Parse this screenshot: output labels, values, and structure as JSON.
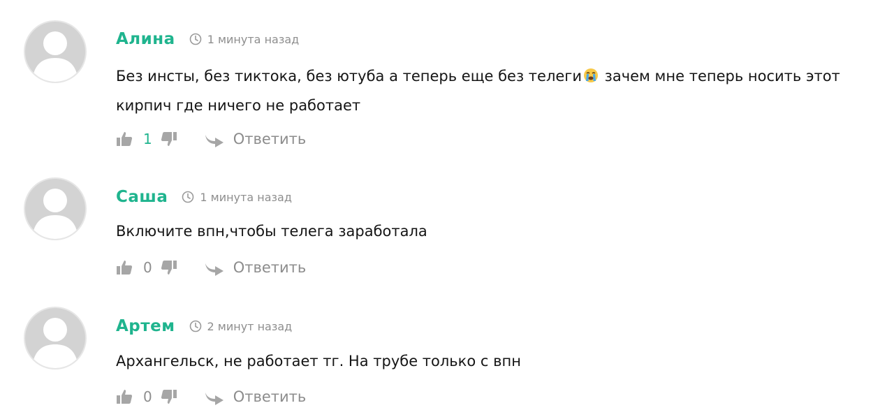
{
  "colors": {
    "accent": "#1fb48e",
    "muted": "#8e8e8e",
    "avatar_bg": "#d3d3d3",
    "icon": "#a6a6a6"
  },
  "comments": [
    {
      "author": "Алина",
      "time": "1 минута назад",
      "text_before_emoji": "Без инсты, без тиктока, без ютуба а теперь еще без телеги",
      "emoji": "loudly-crying-face-emoji",
      "text_after_emoji": " зачем мне теперь носить этот кирпич где ничего не работает",
      "likes": "1",
      "reply_label": "Ответить"
    },
    {
      "author": "Саша",
      "time": "1 минута назад",
      "text_before_emoji": "Включите впн,чтобы телега заработала",
      "text_after_emoji": "",
      "likes": "0",
      "reply_label": "Ответить"
    },
    {
      "author": "Артем",
      "time": "2 минут назад",
      "text_before_emoji": "Архангельск, не работает тг. На трубе только с впн",
      "text_after_emoji": "",
      "likes": "0",
      "reply_label": "Ответить"
    }
  ],
  "icons": {
    "avatar": "default-avatar-icon",
    "clock": "clock-icon",
    "like": "thumbs-up-icon",
    "dislike": "thumbs-down-icon",
    "reply": "reply-arrow-icon"
  }
}
